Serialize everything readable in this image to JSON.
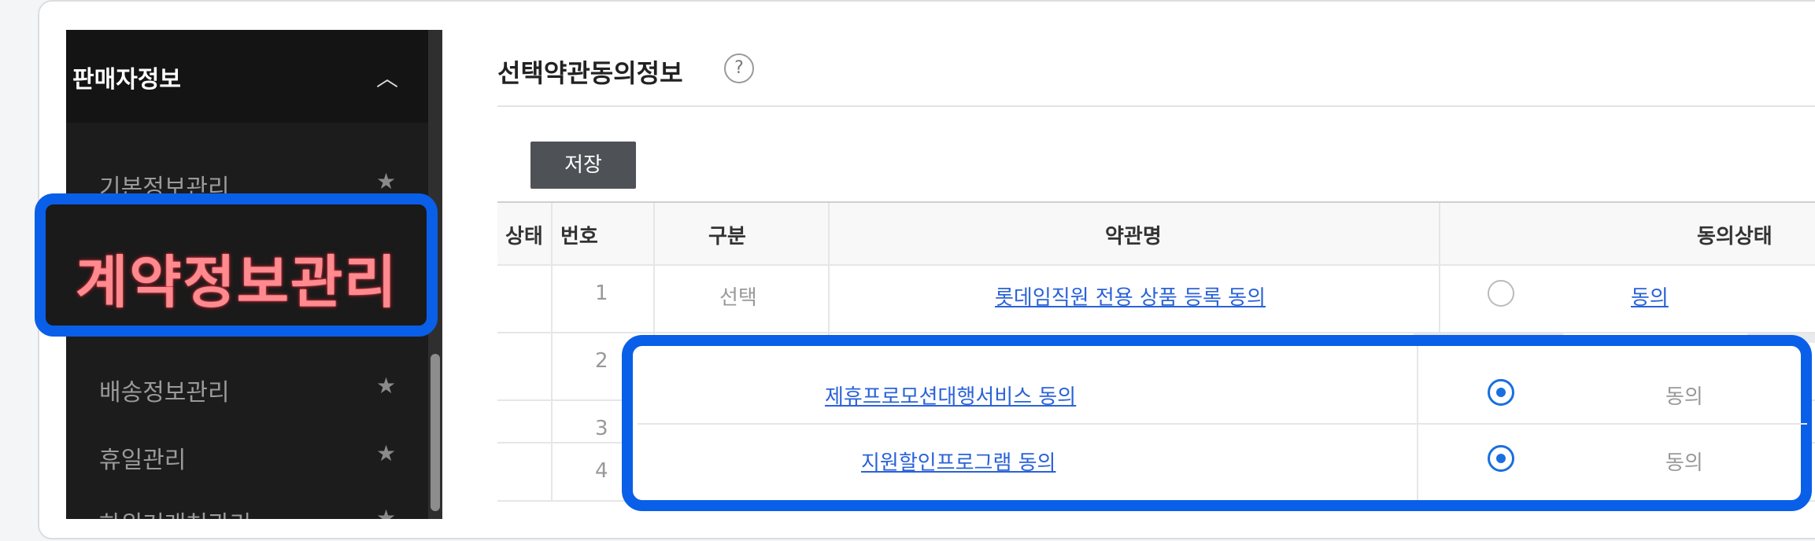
{
  "sidebar": {
    "header": "판매자정보",
    "items": [
      {
        "label": "기본정보관리"
      },
      {
        "label": "배송정보관리"
      },
      {
        "label": "휴일관리"
      },
      {
        "label": "하위거래처관리"
      }
    ],
    "highlighted": "계약정보관리"
  },
  "main": {
    "title": "선택약관동의정보",
    "help": "?",
    "save_label": "저장",
    "columns": [
      "상태",
      "번호",
      "구분",
      "약관명",
      "동의상태"
    ],
    "rows": [
      {
        "number": "1",
        "type": "선택",
        "name": "롯데임직원 전용 상품 등록 동의",
        "consent": "동의",
        "selected": false
      },
      {
        "number": "2",
        "name": "제휴프로모션대행서비스 동의",
        "consent": "동의",
        "selected": true
      },
      {
        "number": "3",
        "name": "지원할인프로그램 동의",
        "consent": "동의",
        "selected": true
      },
      {
        "number": "4"
      }
    ]
  },
  "colors": {
    "accent": "#0a5fe8",
    "highlight_text": "#ff8a8f",
    "link": "#2a62d8"
  }
}
